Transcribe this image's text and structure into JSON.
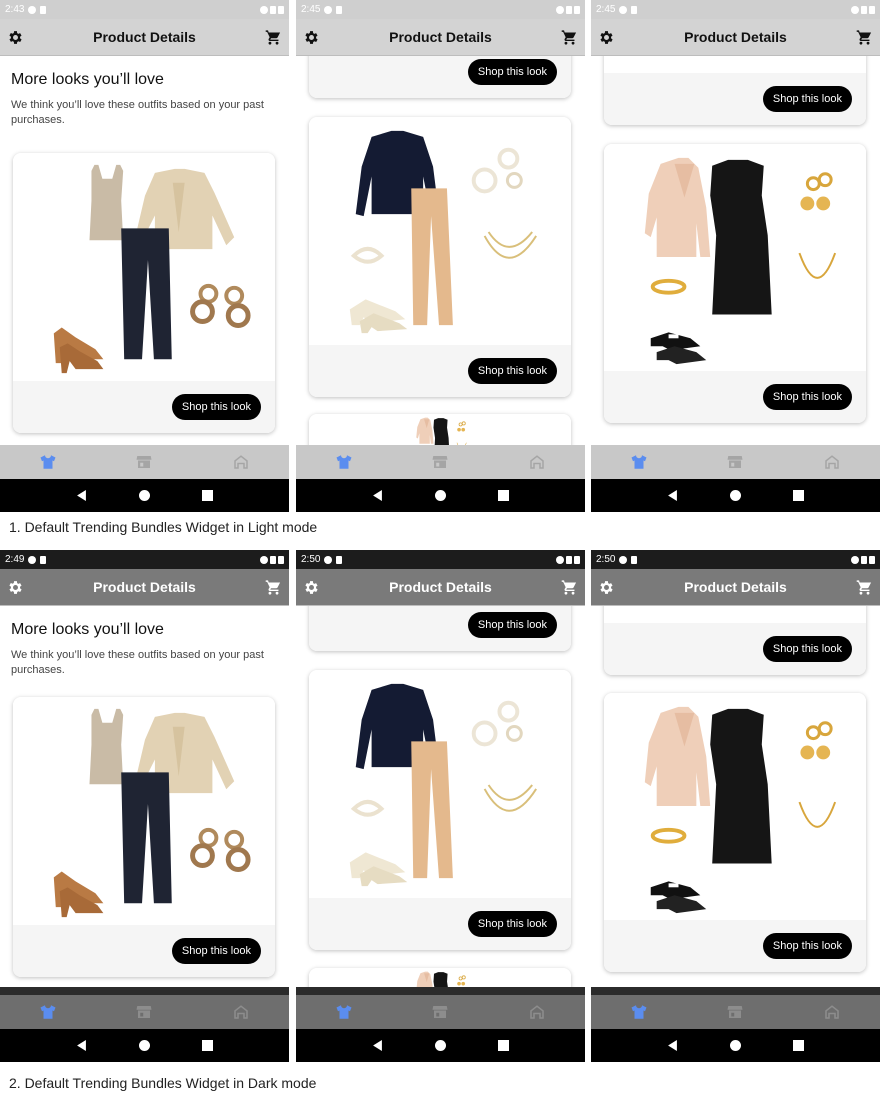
{
  "common": {
    "title": "Product Details",
    "section_heading": "More looks you’ll love",
    "section_subtitle": "We think you’ll love these outfits based on your past purchases.",
    "shop_button": "Shop this look",
    "icons": {
      "settings": "gear-icon",
      "cart": "cart-icon",
      "nav_shirt": "shirt-icon",
      "nav_store": "store-icon",
      "nav_home": "home-icon",
      "back": "back-triangle-icon",
      "home": "home-circle-icon",
      "recents": "recents-square-icon"
    },
    "colors": {
      "nav_active": "#5b8def",
      "button_bg": "#000000",
      "light_appbar": "#d3d3d3",
      "dark_appbar": "#7a7a7a"
    }
  },
  "light": {
    "times": [
      "2:43",
      "2:45",
      "2:45"
    ]
  },
  "dark": {
    "times": [
      "2:49",
      "2:50",
      "2:50"
    ]
  },
  "captions": {
    "light": "1. Default Trending Bundles Widget in Light mode",
    "dark": "2. Default Trending Bundles Widget in Dark mode"
  }
}
